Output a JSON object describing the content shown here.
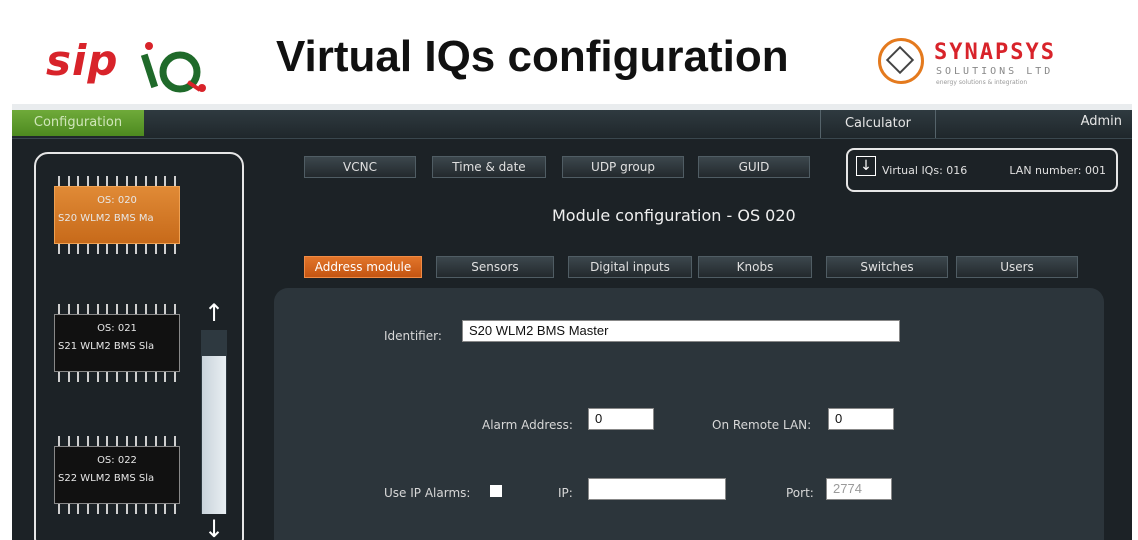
{
  "banner": {
    "title": "Virtual IQs configuration",
    "logo_left": "sip",
    "logo_company": "SYNAPSYS",
    "logo_company_sub": "SOLUTIONS LTD",
    "logo_company_tag": "energy solutions & integration"
  },
  "menu": {
    "configuration": "Configuration",
    "calculator": "Calculator",
    "admin": "Admin"
  },
  "sidebar": {
    "items": [
      {
        "os": "OS:  020",
        "name": "S20 WLM2 BMS Ma",
        "active": true
      },
      {
        "os": "OS:  021",
        "name": "S21 WLM2 BMS Sla",
        "active": false
      },
      {
        "os": "OS:  022",
        "name": "S22 WLM2 BMS Sla",
        "active": false
      }
    ],
    "scroll_up_icon": "arrow-up-icon",
    "scroll_down_icon": "arrow-down-icon"
  },
  "toolbar": {
    "vcnc": "VCNC",
    "time_date": "Time & date",
    "udp_group": "UDP group",
    "guid": "GUID"
  },
  "virtual_box": {
    "virtual_iqs": "Virtual IQs: 016",
    "lan_number": "LAN number: 001",
    "download_icon": "download-icon"
  },
  "module_title": "Module configuration - OS 020",
  "tabs": {
    "address_module": "Address module",
    "sensors": "Sensors",
    "digital_inputs": "Digital inputs",
    "knobs": "Knobs",
    "switches": "Switches",
    "users": "Users"
  },
  "form": {
    "identifier_label": "Identifier:",
    "identifier_value": "S20 WLM2 BMS Master",
    "alarm_address_label": "Alarm Address:",
    "alarm_address_value": "0",
    "remote_lan_label": "On Remote LAN:",
    "remote_lan_value": "0",
    "use_ip_alarms_label": "Use IP Alarms:",
    "ip_label": "IP:",
    "ip_value": "",
    "port_label": "Port:",
    "port_value": "2774"
  },
  "colors": {
    "accent_orange": "#c45512",
    "config_green": "#4d8a20",
    "brand_red": "#d8232a"
  }
}
